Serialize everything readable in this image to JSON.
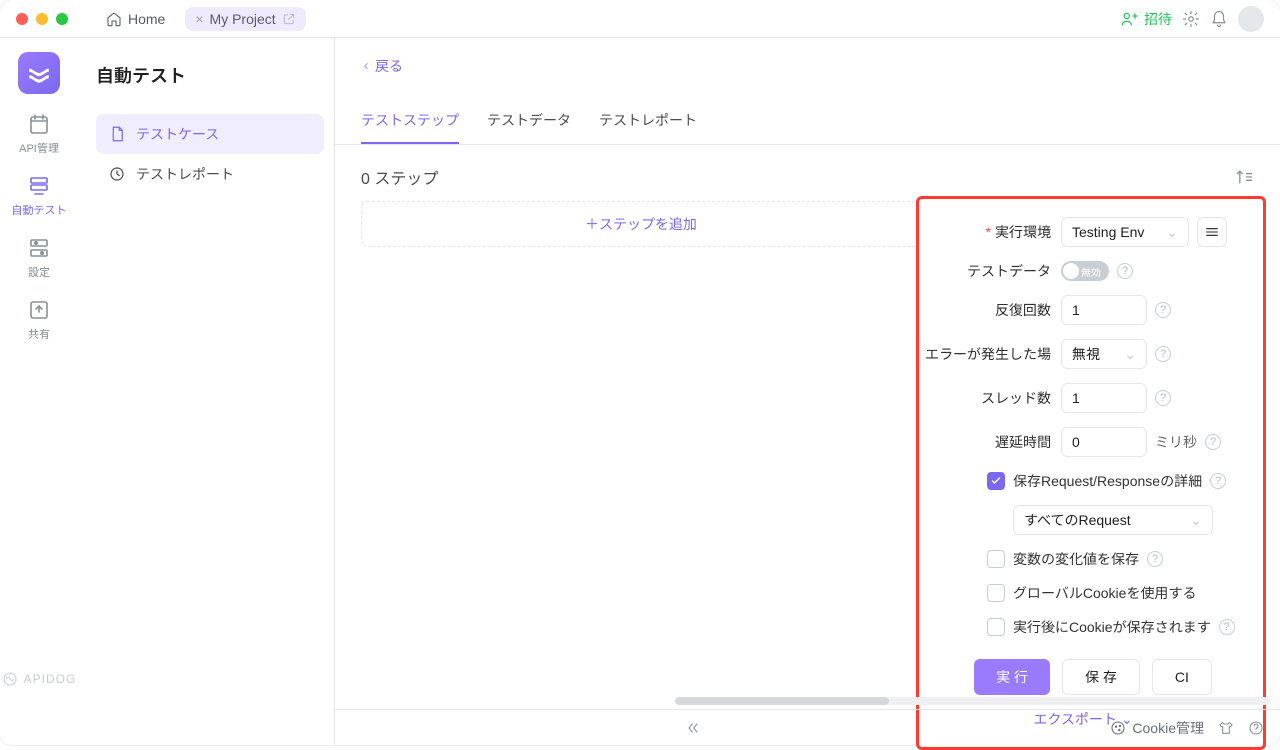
{
  "titlebar": {
    "home_label": "Home",
    "project_close": "×",
    "project_label": "My Project",
    "invite": "招待"
  },
  "rail": {
    "items": [
      {
        "name": "api-management",
        "label": "API管理"
      },
      {
        "name": "auto-test",
        "label": "自動テスト"
      },
      {
        "name": "settings",
        "label": "設定"
      },
      {
        "name": "share",
        "label": "共有"
      }
    ],
    "brand": "APIDOG"
  },
  "side": {
    "title": "自動テスト",
    "nav": [
      {
        "name": "test-cases",
        "label": "テストケース"
      },
      {
        "name": "test-reports",
        "label": "テストレポート"
      }
    ]
  },
  "content": {
    "back": "戻る",
    "tabs": [
      {
        "name": "test-steps",
        "label": "テストステップ"
      },
      {
        "name": "test-data",
        "label": "テストデータ"
      },
      {
        "name": "test-report",
        "label": "テストレポート"
      }
    ],
    "step_count": "0 ステップ",
    "add_step": "＋ステップを追加"
  },
  "config": {
    "env_label": "実行環境",
    "env_value": "Testing Env",
    "testdata_label": "テストデータ",
    "testdata_toggle": "無効",
    "repeat_label": "反復回数",
    "repeat_value": "1",
    "onerror_label": "エラーが発生した場",
    "onerror_value": "無視",
    "threads_label": "スレッド数",
    "threads_value": "1",
    "delay_label": "遅延時間",
    "delay_value": "0",
    "delay_unit": "ミリ秒",
    "save_reqres": "保存Request/Responseの詳細",
    "all_requests": "すべてのRequest",
    "save_vars": "変数の変化値を保存",
    "use_global_cookie": "グローバルCookieを使用する",
    "save_cookie_after": "実行後にCookieが保存されます",
    "run": "実 行",
    "save": "保 存",
    "ci": "CI",
    "export": "エクスポート"
  },
  "status": {
    "cookie": "Cookie管理"
  }
}
